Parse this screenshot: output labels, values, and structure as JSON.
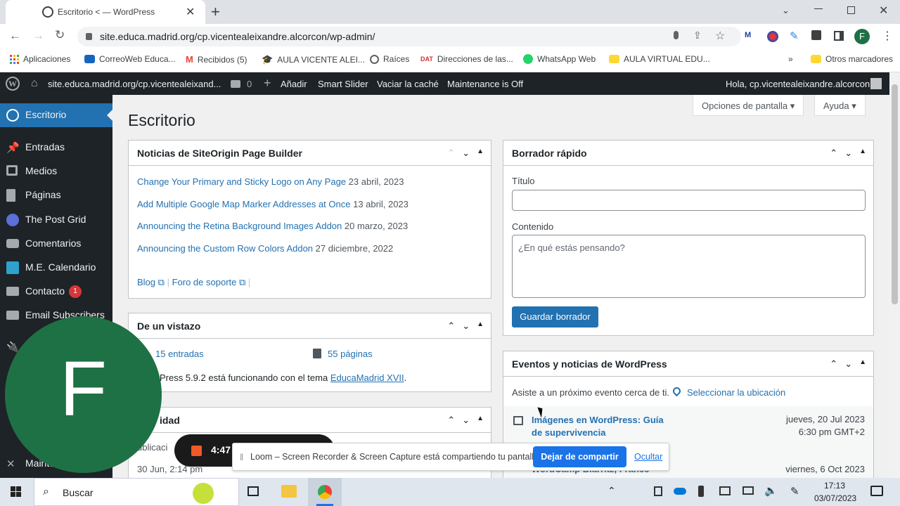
{
  "browser": {
    "tab_title": "Escritorio < — WordPress",
    "url": "site.educa.madrid.org/cp.vicentealeixandre.alcorcon/wp-admin/",
    "profile_letter": "F",
    "bookmarks": [
      {
        "label": "Aplicaciones",
        "color": "#4285f4"
      },
      {
        "label": "CorreoWeb Educa...",
        "color": "#1565c0"
      },
      {
        "label": "Recibidos (5)",
        "color": "#ea4335"
      },
      {
        "label": "AULA VICENTE ALEI...",
        "color": "#1a237e"
      },
      {
        "label": "Raíces",
        "color": "#616161"
      },
      {
        "label": "Direcciones de las...",
        "color": "#d32f2f"
      },
      {
        "label": "WhatsApp Web",
        "color": "#25d366"
      },
      {
        "label": "AULA VIRTUAL EDU...",
        "color": "#fdd835"
      }
    ],
    "more_bookmarks_chevron": "»",
    "other_bookmarks": "Otros marcadores",
    "dat_badge": "DAT"
  },
  "adminbar": {
    "site": "site.educa.madrid.org/cp.vicentealeixand...",
    "comments": "0",
    "add": "Añadir",
    "smart_slider": "Smart Slider",
    "clear_cache": "Vaciar la caché",
    "maintenance": "Maintenance is Off",
    "greeting": "Hola, cp.vicentealeixandre.alcorcon"
  },
  "sidebar": {
    "items": [
      {
        "label": "Escritorio"
      },
      {
        "label": "Entradas"
      },
      {
        "label": "Medios"
      },
      {
        "label": "Páginas"
      },
      {
        "label": "The Post Grid"
      },
      {
        "label": "Comentarios"
      },
      {
        "label": "M.E. Calendario"
      },
      {
        "label": "Contacto",
        "badge": "1"
      },
      {
        "label": "Email Subscribers"
      },
      {
        "label": "Mainte"
      }
    ]
  },
  "page": {
    "title": "Escritorio",
    "screen_options": "Opciones de pantalla",
    "help": "Ayuda"
  },
  "siteorigin": {
    "title": "Noticias de SiteOrigin Page Builder",
    "news": [
      {
        "title": "Change Your Primary and Sticky Logo on Any Page",
        "date": "23 abril, 2023"
      },
      {
        "title": "Add Multiple Google Map Marker Addresses at Once",
        "date": "13 abril, 2023"
      },
      {
        "title": "Announcing the Retina Background Images Addon",
        "date": "20 marzo, 2023"
      },
      {
        "title": "Announcing the Custom Row Colors Addon",
        "date": "27 diciembre, 2022"
      }
    ],
    "blog": "Blog",
    "support": "Foro de soporte",
    "separator": "|"
  },
  "glance": {
    "title": "De un vistazo",
    "entries": "15 entradas",
    "pages": "55 páginas",
    "version": "Press 5.9.2 está funcionando con el tema",
    "theme": "EducaMadrid XVII",
    "period": "."
  },
  "activity": {
    "title": "idad",
    "published": "ublicaci",
    "date": "30 Jun, 2:14 pm"
  },
  "quickdraft": {
    "title": "Borrador rápido",
    "title_label": "Título",
    "title_value": "",
    "content_label": "Contenido",
    "content_placeholder": "¿En qué estás pensando?",
    "save": "Guardar borrador"
  },
  "events": {
    "title": "Eventos y noticias de WordPress",
    "intro": "Asiste a un próximo evento cerca de ti.",
    "select_location": "Seleccionar la ubicación",
    "event1_title": "Imágenes en WordPress: Guía de supervivencia",
    "event1_date": "jueves, 20 Jul 2023",
    "event1_time": "6:30 pm GMT+2",
    "event2_title": "WordCamp Biarritz, France",
    "event2_date": "viernes, 6 Oct 2023"
  },
  "recording": {
    "timer": "4:47"
  },
  "loom": {
    "message": "Loom – Screen Recorder & Screen Capture está compartiendo tu pantalla.",
    "stop": "Dejar de compartir",
    "hide": "Ocultar"
  },
  "avatar_letter": "F",
  "taskbar": {
    "search": "Buscar",
    "time": "17:13",
    "date": "03/07/2023"
  },
  "colors": {
    "wp_blue": "#2271b1",
    "admin_dark": "#1d2327",
    "badge_red": "#d63638",
    "avatar_green": "#1e7145"
  }
}
